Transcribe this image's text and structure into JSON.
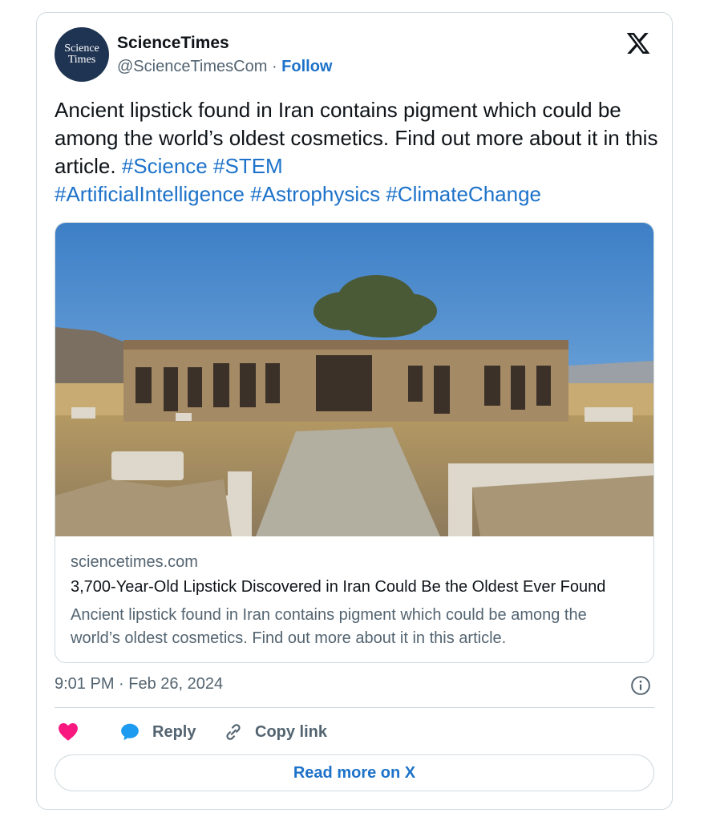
{
  "author": {
    "avatar_text_line1": "Science",
    "avatar_text_line2": "Times",
    "display_name": "ScienceTimes",
    "handle": "@ScienceTimesCom",
    "separator": " · ",
    "follow_label": "Follow"
  },
  "tweet": {
    "text": "Ancient lipstick found in Iran contains pigment which could be among the world’s oldest cosmetics. Find out more about it in this article. ",
    "hashtags": [
      "#Science",
      "#STEM",
      "#ArtificialIntelligence",
      "#Astrophysics",
      "#ClimateChange"
    ],
    "timestamp": "9:01 PM · Feb 26, 2024"
  },
  "link_card": {
    "domain": "sciencetimes.com",
    "title": "3,700-Year-Old Lipstick Discovered in Iran Could Be the Oldest Ever Found",
    "description": "Ancient lipstick found in Iran contains pigment which could be among the world’s oldest cosmetics. Find out more about it in this article."
  },
  "actions": {
    "reply_label": "Reply",
    "copy_link_label": "Copy link",
    "read_more_label": "Read more on X"
  },
  "icons": [
    "x-logo-icon",
    "info-icon",
    "heart-icon",
    "reply-bubble-icon",
    "link-icon"
  ],
  "colors": {
    "link_blue": "#1d72c9",
    "like_pink": "#f91880",
    "reply_blue": "#1d9bf0",
    "avatar_bg": "#1f3452",
    "border": "#cfd9de",
    "secondary_text": "#536471"
  }
}
